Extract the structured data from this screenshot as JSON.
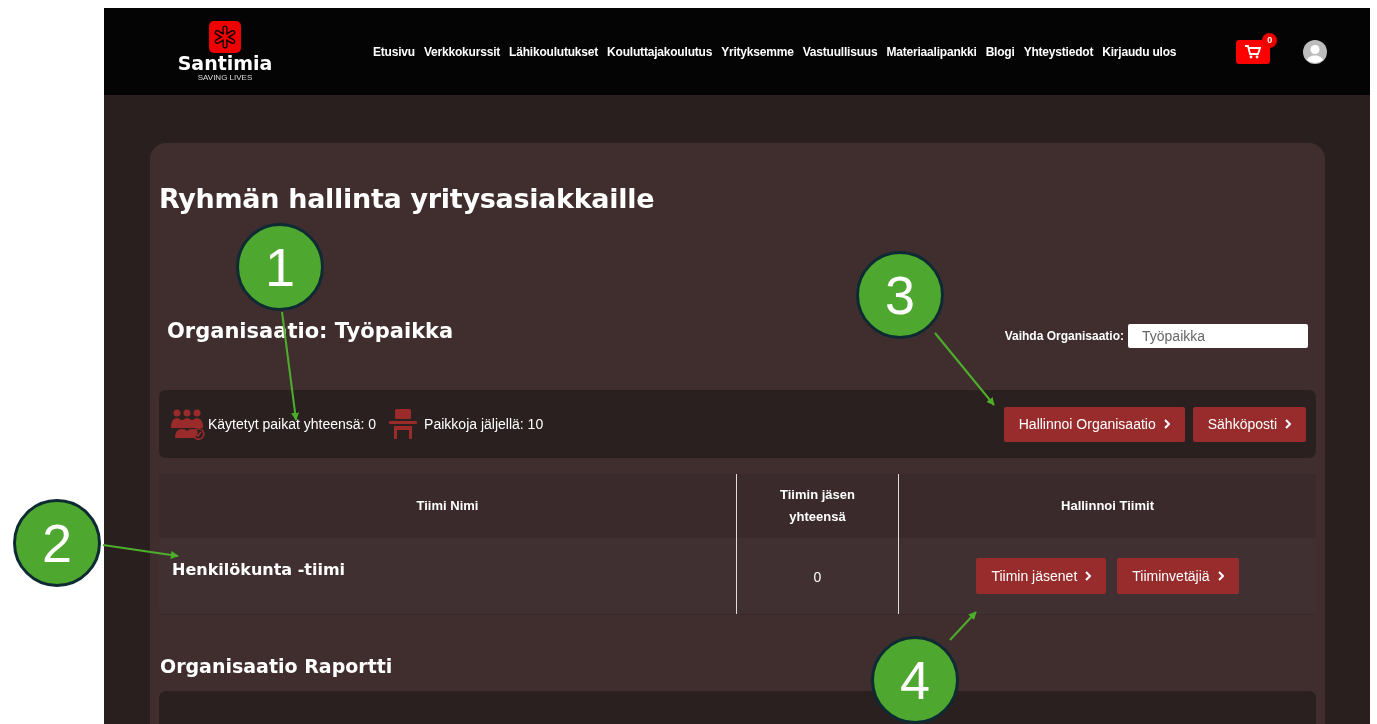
{
  "header": {
    "logo": {
      "name": "Santimia",
      "tagline": "SAVING LIVES"
    },
    "nav": [
      "Etusivu",
      "Verkkokurssit",
      "Lähikoulutukset",
      "Kouluttajakoulutus",
      "Yrityksemme",
      "Vastuullisuus",
      "Materiaalipankki",
      "Blogi",
      "Yhteystiedot",
      "Kirjaudu ulos"
    ],
    "cart_count": "0"
  },
  "title": "Ryhmän hallinta yritysasiakkaille",
  "organization": {
    "heading": "Organisaatio: Työpaikka",
    "switch_label": "Vaihda Organisaatio:",
    "switch_value": "Työpaikka"
  },
  "stats": [
    {
      "kind": "people",
      "text": "Käytetyt paikat yhteensä: 0"
    },
    {
      "kind": "seat",
      "text": "Paikkoja jäljellä: 10"
    }
  ],
  "org_buttons": [
    "Hallinnoi Organisaatio",
    "Sähköposti"
  ],
  "table": {
    "columns": [
      "Tiimi Nimi",
      "Tiimin jäsen yhteensä",
      "Hallinnoi Tiimit"
    ],
    "rows": [
      {
        "name": "Henkilökunta -tiimi",
        "members": "0",
        "buttons": [
          "Tiimin jäsenet",
          "Tiiminvetäjiä"
        ]
      }
    ]
  },
  "report_heading": "Organisaatio Raportti",
  "callouts": [
    {
      "label": "1"
    },
    {
      "label": "2"
    },
    {
      "label": "3"
    },
    {
      "label": "4"
    }
  ]
}
